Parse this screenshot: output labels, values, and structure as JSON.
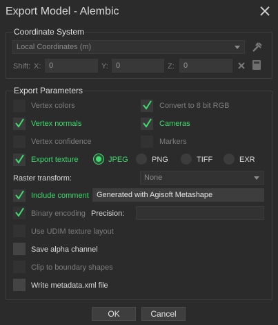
{
  "window": {
    "title": "Export Model - Alembic"
  },
  "coordinate_system": {
    "title": "Coordinate System",
    "crs_value": "Local Coordinates (m)",
    "shift_label": "Shift:",
    "x_label": "X:",
    "x_value": "0",
    "y_label": "Y:",
    "y_value": "0",
    "z_label": "Z:",
    "z_value": "0"
  },
  "export_parameters": {
    "title": "Export Parameters",
    "vertex_colors": {
      "label": "Vertex colors",
      "checked": false
    },
    "convert_8bit": {
      "label": "Convert to 8 bit RGB",
      "checked": true
    },
    "vertex_normals": {
      "label": "Vertex normals",
      "checked": true
    },
    "cameras": {
      "label": "Cameras",
      "checked": true
    },
    "vertex_confidence": {
      "label": "Vertex confidence",
      "checked": false
    },
    "markers": {
      "label": "Markers",
      "checked": false
    },
    "export_texture": {
      "label": "Export texture",
      "checked": true
    },
    "formats": [
      "JPEG",
      "PNG",
      "TIFF",
      "EXR"
    ],
    "selected_format": "JPEG",
    "raster_transform_label": "Raster transform:",
    "raster_transform_value": "None",
    "include_comment": {
      "label": "Include comment",
      "checked": true
    },
    "comment_value": "Generated with Agisoft Metashape",
    "binary_encoding": {
      "label": "Binary encoding",
      "checked": true
    },
    "precision_label": "Precision:",
    "precision_value": "",
    "udim": {
      "label": "Use UDIM texture layout",
      "checked": false
    },
    "save_alpha": {
      "label": "Save alpha channel",
      "checked": false
    },
    "clip_boundary": {
      "label": "Clip to boundary shapes",
      "checked": false
    },
    "write_metadata": {
      "label": "Write metadata.xml file",
      "checked": false
    }
  },
  "buttons": {
    "ok": "OK",
    "cancel": "Cancel"
  },
  "colors": {
    "accent": "#3fdc6e",
    "background": "#2b2b2b"
  }
}
